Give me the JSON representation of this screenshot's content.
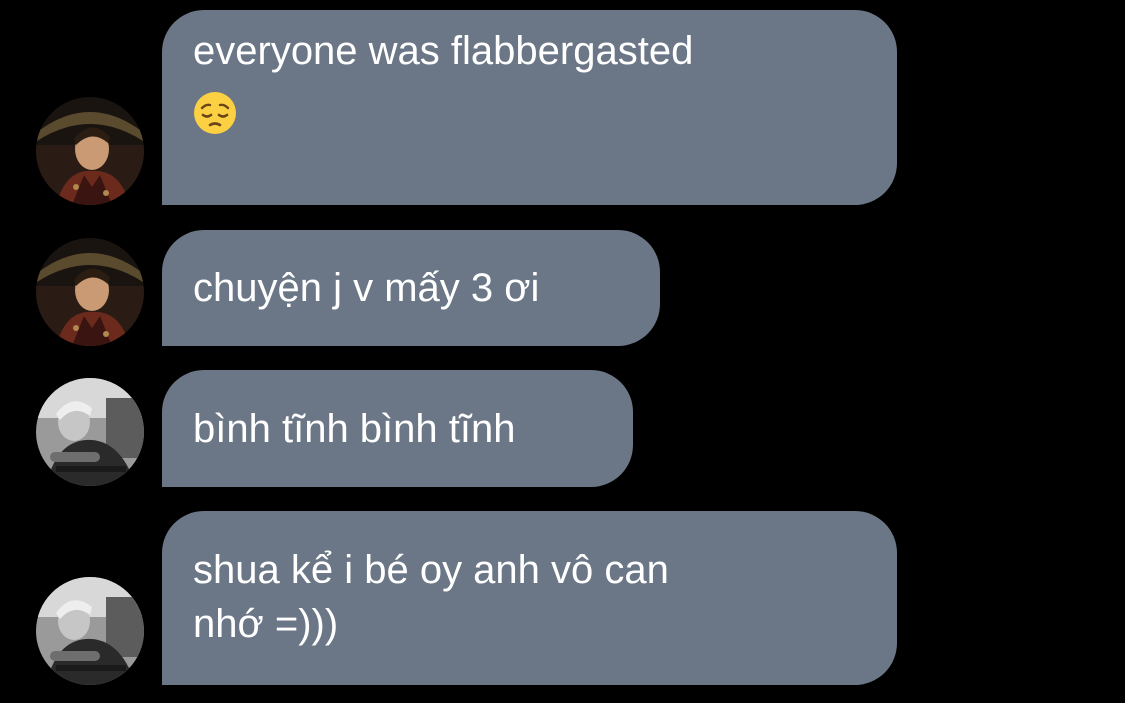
{
  "conversation": {
    "messages": [
      {
        "sender_avatar": "avatar-man-umbrella",
        "lines": [
          "everyone was flabbergasted"
        ],
        "emoji": "pensive-face-emoji"
      },
      {
        "sender_avatar": "avatar-man-umbrella",
        "lines": [
          "chuyện j v mấy 3 ơi"
        ]
      },
      {
        "sender_avatar": "avatar-man-bw",
        "lines": [
          "bình tĩnh bình tĩnh"
        ]
      },
      {
        "sender_avatar": "avatar-man-bw",
        "lines": [
          "shua kể i bé oy anh vô can",
          "nhớ =)))"
        ]
      }
    ]
  },
  "colors": {
    "background": "#000000",
    "bubble": "#6b7786",
    "text": "#ffffff"
  }
}
